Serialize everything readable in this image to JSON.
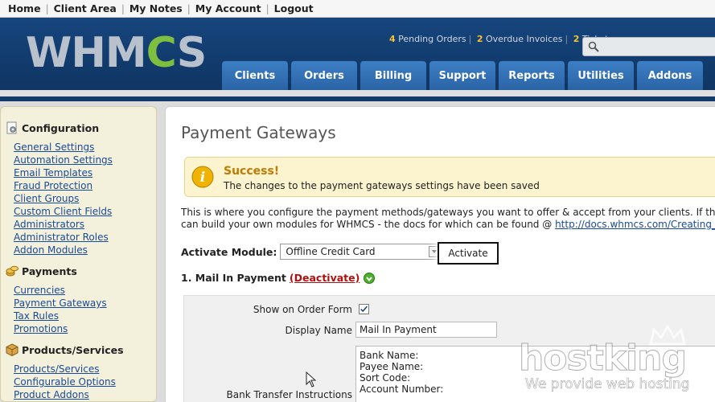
{
  "topbar": {
    "links": [
      "Home",
      "Client Area",
      "My Notes",
      "My Account",
      "Logout"
    ]
  },
  "header": {
    "logo_text": "WHM",
    "logo_cog": "C",
    "logo_tail": "S",
    "stats": [
      {
        "num": "4",
        "label": "Pending Orders"
      },
      {
        "num": "2",
        "label": "Overdue Invoices"
      },
      {
        "num": "2",
        "label": "Ticket"
      }
    ],
    "nav": [
      "Clients",
      "Orders",
      "Billing",
      "Support",
      "Reports",
      "Utilities",
      "Addons"
    ]
  },
  "sidebar": {
    "groups": [
      {
        "title": "Configuration",
        "icon": "gear-page-icon",
        "links": [
          "General Settings",
          "Automation Settings",
          "Email Templates",
          "Fraud Protection",
          "Client Groups",
          "Custom Client Fields",
          "Administrators",
          "Administrator Roles",
          "Addon Modules"
        ]
      },
      {
        "title": "Payments",
        "icon": "coins-icon",
        "links": [
          "Currencies",
          "Payment Gateways",
          "Tax Rules",
          "Promotions"
        ]
      },
      {
        "title": "Products/Services",
        "icon": "box-icon",
        "links": [
          "Products/Services",
          "Configurable Options",
          "Product Addons"
        ]
      }
    ]
  },
  "main": {
    "title": "Payment Gateways",
    "success_title": "Success!",
    "success_text": "The changes to the payment gateways settings have been saved",
    "intro_line1": "This is where you configure the payment methods/gateways you want to offer & accept from your clients. If the gatew",
    "intro_line2": "can build your own modules for WHMCS - the docs for which can be found @",
    "intro_link": "http://docs.whmcs.com/Creating_Modules",
    "activate_label": "Activate Module:",
    "module_selected": "Offline Credit Card",
    "activate_button": "Activate",
    "module_heading": "1. Mail In Payment",
    "deactivate_link": "(Deactivate)",
    "fields": {
      "show_on_order_label": "Show on Order Form",
      "show_on_order_checked": true,
      "display_name_label": "Display Name",
      "display_name_value": "Mail In Payment",
      "bank_label": "Bank Transfer Instructions",
      "bank_lines": [
        "Bank Name:",
        "Payee Name:",
        "Sort Code:",
        "Account Number:"
      ]
    }
  },
  "watermark": {
    "brand": "hostking",
    "tagline": "We provide web hosting"
  },
  "colors": {
    "header_blue": "#16457d",
    "tab_blue": "#3d7ec4",
    "success_bg": "#fbf4cf",
    "success_title": "#c17a00",
    "link_blue": "#1a4a96",
    "deactivate_red": "#b01010"
  }
}
